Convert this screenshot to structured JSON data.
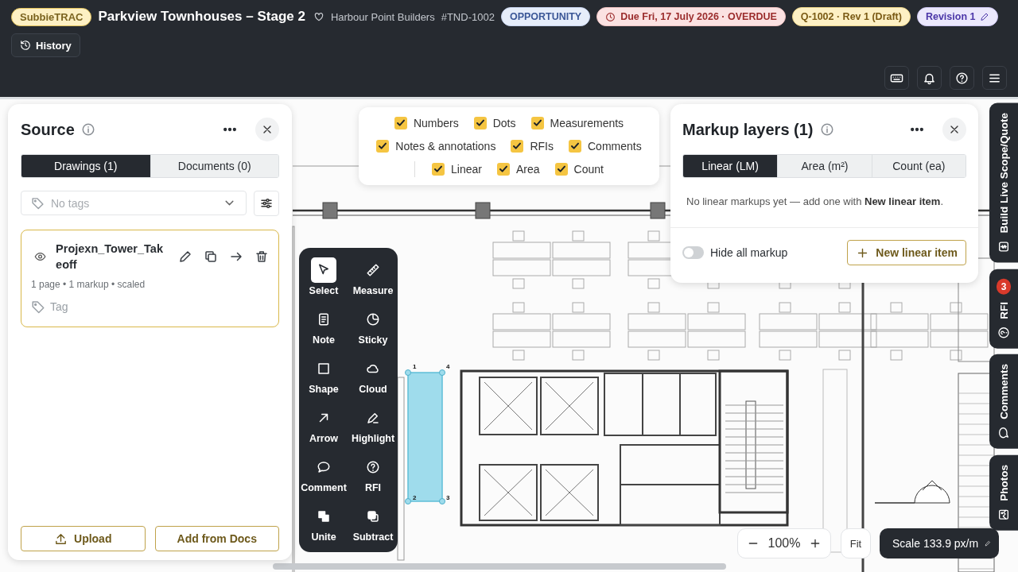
{
  "header": {
    "logo": "SubbieTRAC",
    "title": "Parkview Townhouses – Stage 2",
    "client": "Harbour Point Builders",
    "reference": "#TND-1002",
    "badges": [
      {
        "kind": "stage",
        "text": "OPPORTUNITY"
      },
      {
        "kind": "due",
        "text": "Due Fri, 17 July 2026 · OVERDUE"
      },
      {
        "kind": "quote",
        "text": "Q-1002 · Rev 1 (Draft)"
      },
      {
        "kind": "revision",
        "text": "Revision 1"
      }
    ],
    "history_button": "History"
  },
  "source_panel": {
    "title": "Source",
    "tabs": [
      {
        "label": "Drawings (1)",
        "selected": true
      },
      {
        "label": "Documents (0)",
        "selected": false
      }
    ],
    "tag_filter": {
      "placeholder": "No tags"
    },
    "drawings": [
      {
        "name": "Projexn_Tower_Takeoff",
        "meta": "1 page • 1 markup • scaled",
        "tag": "Tag"
      }
    ],
    "buttons": [
      {
        "kind": "upload",
        "label": "Upload"
      },
      {
        "kind": "plain",
        "label": "Add from Docs"
      }
    ]
  },
  "layer_filter_rows": [
    {
      "separated": false,
      "items": [
        {
          "label": "Numbers",
          "checked": true
        },
        {
          "label": "Dots",
          "checked": true
        },
        {
          "label": "Measurements",
          "checked": true
        }
      ]
    },
    {
      "separated": false,
      "items": [
        {
          "label": "Notes & annotations",
          "checked": true
        },
        {
          "label": "RFIs",
          "checked": true
        },
        {
          "label": "Comments",
          "checked": true
        }
      ]
    },
    {
      "separated": true,
      "items": [
        {
          "label": "Linear",
          "checked": true
        },
        {
          "label": "Area",
          "checked": true
        },
        {
          "label": "Count",
          "checked": true
        }
      ]
    }
  ],
  "markup_panel": {
    "title": "Markup layers (1)",
    "tabs": [
      {
        "label": "Linear (LM)",
        "selected": true
      },
      {
        "label": "Area (m²)",
        "selected": false
      },
      {
        "label": "Count (ea)",
        "selected": false
      }
    ],
    "empty_message": "No linear markups yet — add one with **New linear item**.",
    "hide_toggle": {
      "label": "Hide all markup",
      "on": false
    },
    "new_button": "New linear item"
  },
  "tools": [
    {
      "kind": "select",
      "label": "Select",
      "selected": true
    },
    {
      "kind": "measure",
      "label": "Measure",
      "selected": false
    },
    {
      "kind": "note",
      "label": "Note",
      "selected": false
    },
    {
      "kind": "sticky",
      "label": "Sticky",
      "selected": false
    },
    {
      "kind": "shape",
      "label": "Shape",
      "selected": false
    },
    {
      "kind": "cloud",
      "label": "Cloud",
      "selected": false
    },
    {
      "kind": "arrow",
      "label": "Arrow",
      "selected": false
    },
    {
      "kind": "highlight",
      "label": "Highlight",
      "selected": false
    },
    {
      "kind": "comment",
      "label": "Comment",
      "selected": false
    },
    {
      "kind": "rfi",
      "label": "RFI",
      "selected": false
    },
    {
      "kind": "unite",
      "label": "Unite",
      "selected": false
    },
    {
      "kind": "subtract",
      "label": "Subtract",
      "selected": false
    }
  ],
  "markup": {
    "vertex_labels": [
      "1",
      "4",
      "2",
      "3"
    ]
  },
  "zoom": {
    "value": "100%",
    "fit": "Fit",
    "scale": "Scale 133.9 px/m"
  },
  "side_tabs": [
    {
      "kind": "scope",
      "label": "Build Live Scope/Quote"
    },
    {
      "kind": "rfi",
      "label": "RFI",
      "badge": "3"
    },
    {
      "kind": "comments",
      "label": "Comments"
    },
    {
      "kind": "photos",
      "label": "Photos"
    }
  ]
}
